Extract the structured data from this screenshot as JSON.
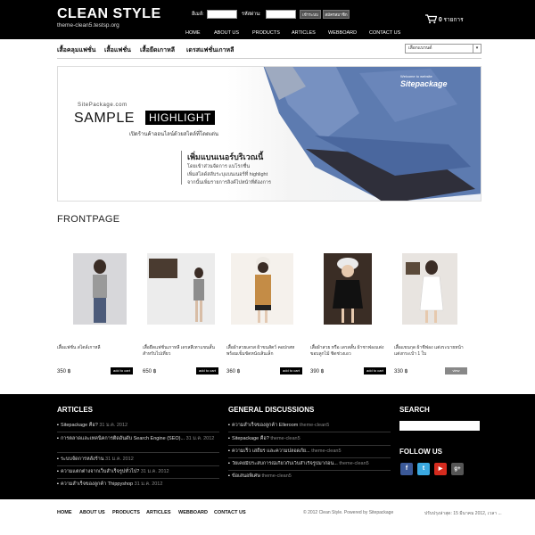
{
  "site": {
    "title": "CLEAN STYLE",
    "subtitle": "theme-clean5.testsp.org"
  },
  "login": {
    "email_label": "อีเมล์:",
    "password_label": "รหัสผ่าน:",
    "login_button": "เข้าระบบ",
    "register_button": "สมัครสมาชิก"
  },
  "cart": {
    "count": "0",
    "unit": "รายการ"
  },
  "nav": [
    "HOME",
    "ABOUT US",
    "PRODUCTS",
    "ARTICLES",
    "WEBBOARD",
    "CONTACT US"
  ],
  "categories": [
    "เสื้อคลุมแฟชั่น",
    "เสื้อแฟชั่น",
    "เสื้อยืดเกาหลี",
    "เดรสแฟชั่นเกาหลี"
  ],
  "category_select": "เลือกแบรนด์",
  "banner": {
    "small": "SitePackage.com",
    "sample": "SAMPLE",
    "highlight": "HIGHLIGHT",
    "sub": "เปิดร้านค้าออนไลน์ด้วยสไตล์ที่โดดเด่น",
    "headline": "เพิ่มแบนเนอร์บริเวณนี้",
    "line1": "โดยเข้าส่วนจัดการ แบโรกชื่น",
    "line2": "เพิ่มสไลด์สลับระบุแบนเนอร์ที่ highlight",
    "line3": "จากนั้นเพิ่มรายการลิงค์ไปหน้าที่ต้องการ",
    "welcome": "Welcome to website",
    "brand": "Sitepackage"
  },
  "frontpage": {
    "title": "FRONTPAGE",
    "products": [
      {
        "name": "เสื้อแฟชั่น สไตล์เกาหลี",
        "price": "350 ฿",
        "button": "add to cart",
        "color": "#d7d7da"
      },
      {
        "name": "เสื้อยืดแฟชั่นเกาหลี เดรสสีเทาแขนสั้นสำหรับไปเที่ยว",
        "price": "650 ฿",
        "button": "add to cart",
        "color": "#e6e6e6"
      },
      {
        "name": "เสื้อผ้าสวยเดรส ผ้าขนสัตว์ คอปกสหพร้อมเข็มขัดหนังเส้นเล็ก",
        "price": "360 ฿",
        "button": "add to cart",
        "color": "#f0e7de"
      },
      {
        "name": "เสื้อผ้าสวย หรือ เดรสสั้น ผ้าชาฟองแต่งขอบลูกไม้ ชิดช่วงเอว",
        "price": "390 ฿",
        "button": "add to cart",
        "color": "#2a1f1a"
      },
      {
        "name": "เสื้อแขนกุด ผ้าชีฟอง แต่งระบายหน้าแต่งกระเป๋า 1 ใบ",
        "price": "330 ฿",
        "button": "view",
        "color": "#e8e4e0"
      }
    ]
  },
  "articles": {
    "title": "ARTICLES",
    "items": [
      {
        "text": "Sitepackage คือ?",
        "date": "31 ม.ค. 2012"
      },
      {
        "text": "การตลาดและเทคนิคการติดอันดับ Search Engine (SEO)...",
        "date": "31 ม.ค. 2012"
      },
      {
        "text": "ระบบจัดการหลังร้าน",
        "date": "31 ม.ค. 2012"
      },
      {
        "text": "ความแตกต่างจากเว็บสำเร็จรูปทั่วไป?",
        "date": "31 ม.ค. 2012"
      },
      {
        "text": "ความสำเร็จของลูกค้า Thippyshop",
        "date": "31 ม.ค. 2012"
      }
    ]
  },
  "discussions": {
    "title": "GENERAL DISCUSSIONS",
    "items": [
      {
        "text": "ความสำเร็จของลูกค้า Elleroom",
        "author": "theme-clean5"
      },
      {
        "text": "Sitepackage คือ?",
        "author": "theme-clean5"
      },
      {
        "text": "ความเร็ว เสถียร และความปลอดภัย...",
        "author": "theme-clean5"
      },
      {
        "text": "วัยเคยมีประสบการณ์เกี่ยวกับเว็บสำเร็จรูปมาก่อน...",
        "author": "theme-clean5"
      },
      {
        "text": "ข้อเสนอพิเศษ",
        "author": "theme-clean5"
      }
    ]
  },
  "search": {
    "title": "SEARCH"
  },
  "follow": {
    "title": "FOLLOW US",
    "icons": [
      {
        "name": "facebook-icon",
        "glyph": "f",
        "color": "#3b5998"
      },
      {
        "name": "twitter-icon",
        "glyph": "t",
        "color": "#3aa8e0"
      },
      {
        "name": "youtube-icon",
        "glyph": "▶",
        "color": "#d52b1e"
      },
      {
        "name": "googleplus-icon",
        "glyph": "g+",
        "color": "#555555"
      }
    ]
  },
  "footer": {
    "nav": [
      "HOME",
      "ABOUT US",
      "PRODUCTS",
      "ARTICLES",
      "WEBBOARD",
      "CONTACT US"
    ],
    "copyright": "© 2012 Clean Style. Powered by Sitepackage",
    "date": "ปรับปรุงล่าสุด: 15 มีนาคม 2012, เวลา ..."
  }
}
